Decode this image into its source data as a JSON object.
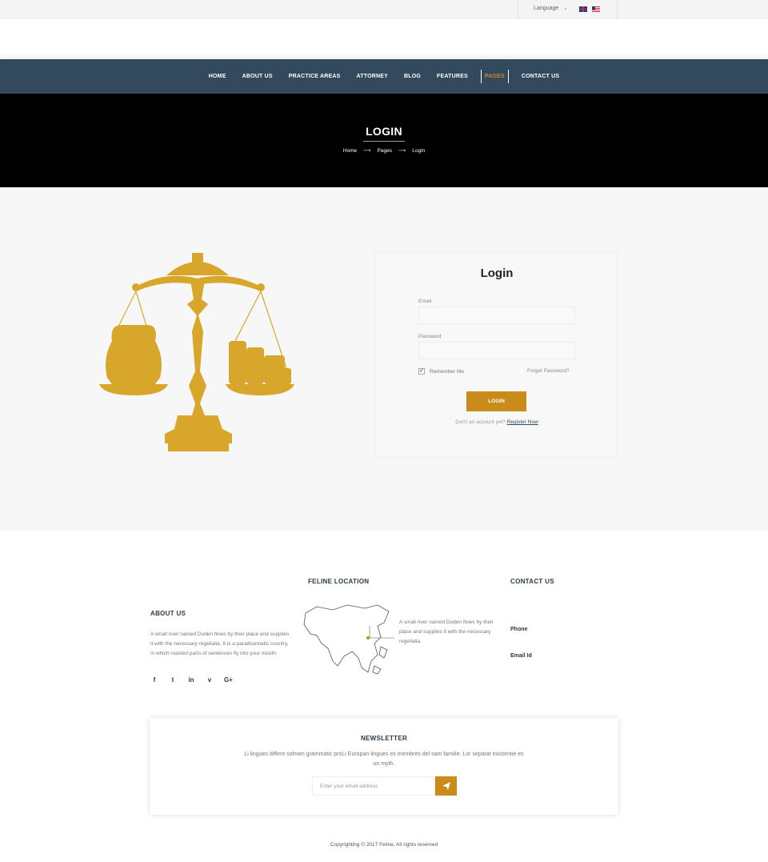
{
  "topbar": {
    "language_label": "Language",
    "caret_icon": "chevron-down-icon",
    "flags": [
      "uk-flag-icon",
      "us-flag-icon"
    ]
  },
  "nav": {
    "items": [
      "HOME",
      "ABOUT US",
      "PRACTICE AREAS",
      "ATTORNEY",
      "BLOG",
      "FEATURES",
      "PAGES",
      "CONTACT US"
    ],
    "active_index": 6
  },
  "hero": {
    "title": "LOGIN",
    "breadcrumb": [
      "Home",
      "Pages",
      "Login"
    ],
    "separator": "⟶"
  },
  "login": {
    "title": "Login",
    "email_label": "Email",
    "email_value": "",
    "password_label": "Password",
    "password_value": "",
    "remember_label": "Remember Me",
    "remember_checked": true,
    "forgot_label": "Forget Password?",
    "button_label": "LOGIN",
    "register_prompt": "Don't an account yet?",
    "register_link": "Register Now"
  },
  "footer": {
    "about": {
      "title": "ABOUT US",
      "text": "A small river named Duden flows by their place and supplies it with the necessary regelialia. It is a paradisematic country, in which roasted parts of sentences fly into your mouth.",
      "social_icons": [
        "facebook-icon",
        "twitter-icon",
        "linkedin-icon",
        "vimeo-icon",
        "google-plus-icon"
      ],
      "social_glyphs": [
        "f",
        "t",
        "in",
        "v",
        "G+"
      ]
    },
    "location": {
      "title": "FELINE LOCATION",
      "text": "A small river named Duden flows by their place and supplies it with the necessary regelialia."
    },
    "contact": {
      "title": "CONTACT US",
      "phone_label": "Phone",
      "email_label": "Email Id"
    }
  },
  "newsletter": {
    "title": "NEWSLETTER",
    "text": "Li lingues differe solmen  grammatic proLi Europan lingues es membres del sam familie. Lor separat existentie es un myth.",
    "input_placeholder": "Enter your email address",
    "send_icon": "paper-plane-icon"
  },
  "copyright": "Copyrighting © 2017 Feline, All rights reserved",
  "colors": {
    "accent": "#c98b1a",
    "nav_bg": "#334a5e",
    "hero_bg": "#000000",
    "section_bg": "#f7f7f7"
  }
}
